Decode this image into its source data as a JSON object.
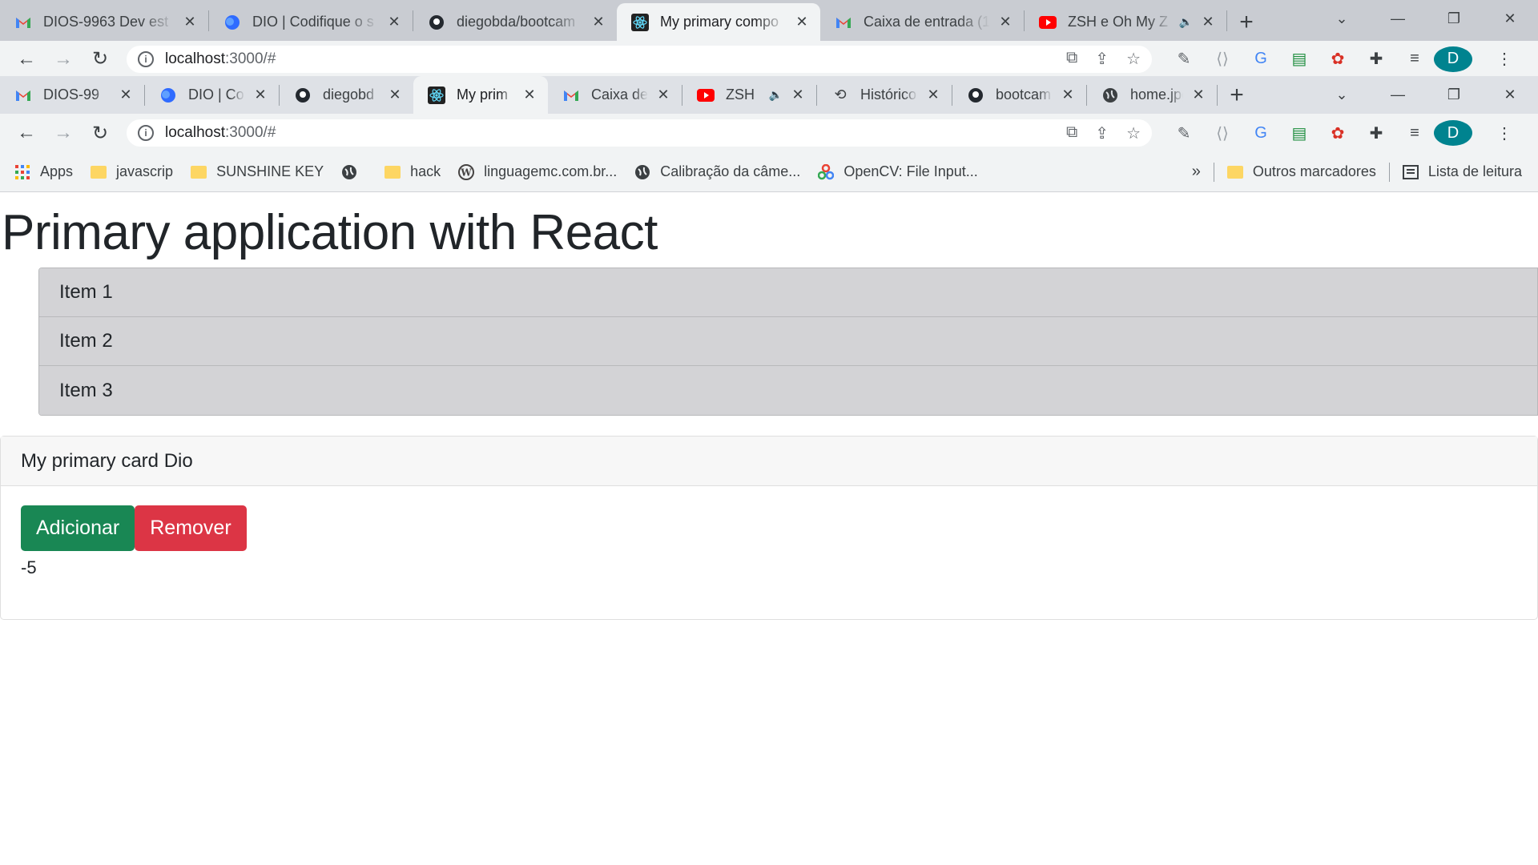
{
  "browser_outer": {
    "tabs": [
      {
        "title": "DIOS-9963 Dev est",
        "icon": "gmail-icon"
      },
      {
        "title": "DIO | Codifique o s",
        "icon": "dio-icon"
      },
      {
        "title": "diegobda/bootcam",
        "icon": "github-icon"
      },
      {
        "title": "My primary compo",
        "icon": "react-icon",
        "active": true
      },
      {
        "title": "Caixa de entrada (1",
        "icon": "gmail-icon"
      },
      {
        "title": "ZSH e Oh My Z",
        "icon": "youtube-icon",
        "audio": true
      }
    ],
    "url_host": "localhost",
    "url_path": ":3000/#"
  },
  "browser_inner": {
    "tabs": [
      {
        "title": "DIOS-99",
        "icon": "gmail-icon"
      },
      {
        "title": "DIO | Co",
        "icon": "dio-icon"
      },
      {
        "title": "diegobd",
        "icon": "github-icon"
      },
      {
        "title": "My prim",
        "icon": "react-icon",
        "active": true
      },
      {
        "title": "Caixa de",
        "icon": "gmail-icon"
      },
      {
        "title": "ZSH",
        "icon": "youtube-icon",
        "audio": true
      },
      {
        "title": "Histórico",
        "icon": "history-icon"
      },
      {
        "title": "bootcam",
        "icon": "github-icon"
      },
      {
        "title": "home.jpg",
        "icon": "globe-icon"
      }
    ],
    "url_host": "localhost",
    "url_path": ":3000/#"
  },
  "bookmarks": {
    "items": [
      "Apps",
      "javascrip",
      "SUNSHINE KEY",
      "",
      "hack",
      "linguagemc.com.br...",
      "Calibração da câme...",
      "OpenCV: File Input..."
    ],
    "overflow": "»",
    "other": "Outros marcadores",
    "reading_list": "Lista de leitura"
  },
  "avatar_letter": "D",
  "page": {
    "title": "Primary application with React",
    "list": [
      "Item 1",
      "Item 2",
      "Item 3"
    ],
    "card": {
      "header": "My primary card Dio",
      "add_label": "Adicionar",
      "remove_label": "Remover",
      "counter": "-5"
    }
  },
  "colors": {
    "add_button": "#198754",
    "remove_button": "#dc3545",
    "list_bg": "#d3d3d6",
    "avatar": "#00838f"
  }
}
